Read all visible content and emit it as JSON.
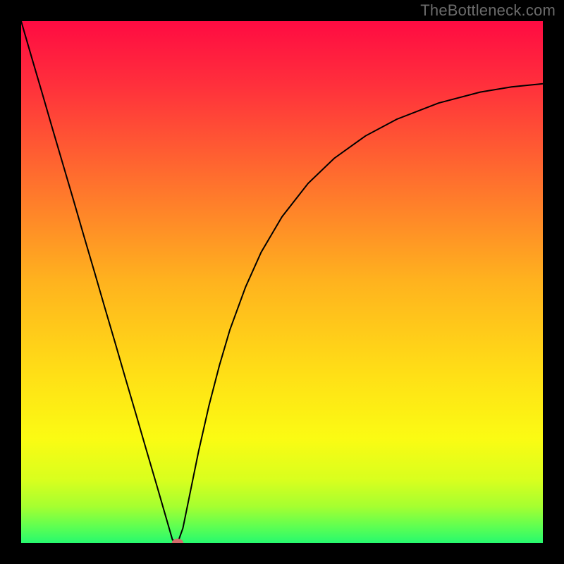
{
  "attribution": "TheBottleneck.com",
  "chart_data": {
    "type": "line",
    "title": "",
    "xlabel": "",
    "ylabel": "",
    "xlim": [
      0,
      100
    ],
    "ylim": [
      0,
      100
    ],
    "grid": false,
    "legend": false,
    "background": {
      "type": "vertical-gradient",
      "stops": [
        {
          "offset": 0.0,
          "color": "#ff0b42"
        },
        {
          "offset": 0.12,
          "color": "#ff2f3c"
        },
        {
          "offset": 0.3,
          "color": "#ff6e2e"
        },
        {
          "offset": 0.5,
          "color": "#ffb31e"
        },
        {
          "offset": 0.68,
          "color": "#ffe016"
        },
        {
          "offset": 0.8,
          "color": "#fbfb13"
        },
        {
          "offset": 0.88,
          "color": "#d8ff1e"
        },
        {
          "offset": 0.93,
          "color": "#a6ff30"
        },
        {
          "offset": 0.97,
          "color": "#5cff53"
        },
        {
          "offset": 1.0,
          "color": "#27f96e"
        }
      ]
    },
    "series": [
      {
        "name": "curve",
        "color": "#000000",
        "x": [
          0.0,
          2,
          4,
          6,
          8,
          10,
          12,
          14,
          16,
          18,
          20,
          22,
          24,
          26,
          27.5,
          29,
          30,
          31,
          32,
          34,
          36,
          38,
          40,
          43,
          46,
          50,
          55,
          60,
          66,
          72,
          80,
          88,
          94,
          100
        ],
        "y": [
          100,
          93.1,
          86.3,
          79.4,
          72.6,
          65.8,
          58.9,
          52.1,
          45.2,
          38.4,
          31.5,
          24.7,
          17.8,
          11.0,
          5.8,
          0.6,
          0.0,
          2.8,
          7.7,
          17.5,
          26.3,
          34.0,
          40.8,
          49.0,
          55.7,
          62.5,
          68.9,
          73.7,
          78.0,
          81.2,
          84.3,
          86.4,
          87.4,
          88.0
        ]
      }
    ],
    "marker": {
      "name": "min-point",
      "x": 30,
      "y": 0,
      "color": "#d46a6a",
      "rx": 1.1,
      "ry": 0.8
    }
  }
}
